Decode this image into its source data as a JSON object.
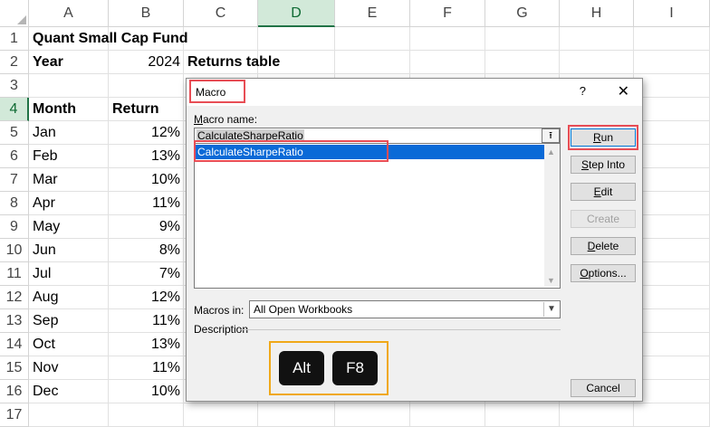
{
  "sheet": {
    "columns": [
      "A",
      "B",
      "C",
      "D",
      "E",
      "F",
      "G",
      "H",
      "I"
    ],
    "selected_column": "D",
    "selected_row": "4",
    "rows": [
      "1",
      "2",
      "3",
      "4",
      "5",
      "6",
      "7",
      "8",
      "9",
      "10",
      "11",
      "12",
      "13",
      "14",
      "15",
      "16",
      "17"
    ],
    "cells": {
      "A1": "Quant Small Cap Fund",
      "A2": "Year",
      "B2": "2024",
      "C2": "Returns table",
      "A4": "Month",
      "B4": "Return",
      "months": [
        "Jan",
        "Feb",
        "Mar",
        "Apr",
        "May",
        "Jun",
        "Jul",
        "Aug",
        "Sep",
        "Oct",
        "Nov",
        "Dec"
      ],
      "returns": [
        "12%",
        "13%",
        "10%",
        "11%",
        "9%",
        "8%",
        "7%",
        "12%",
        "11%",
        "13%",
        "11%",
        "10%"
      ]
    }
  },
  "dialog": {
    "title": "Macro",
    "help": "?",
    "close": "✕",
    "macro_name_label": "Macro name:",
    "macro_name_value": "CalculateSharpeRatio",
    "list_items": [
      "CalculateSharpeRatio"
    ],
    "macros_in_label": "Macros in:",
    "macros_in_value": "All Open Workbooks",
    "description_label": "Description",
    "buttons": {
      "run": "Run",
      "step_into": "Step Into",
      "edit": "Edit",
      "create": "Create",
      "delete": "Delete",
      "options": "Options...",
      "cancel": "Cancel"
    }
  },
  "shortcut": {
    "keys": [
      "Alt",
      "F8"
    ]
  },
  "colors": {
    "highlight_red": "#e84d55",
    "highlight_orange": "#f0a818",
    "selection_blue": "#0a6ad7",
    "excel_green": "#217346"
  }
}
